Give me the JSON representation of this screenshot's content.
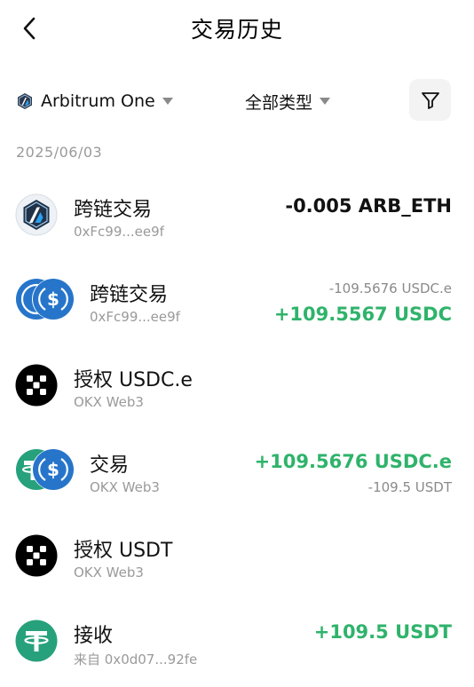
{
  "header": {
    "title": "交易历史"
  },
  "filters": {
    "network_label": "Arbitrum One",
    "type_label": "全部类型"
  },
  "date_group": "2025/06/03",
  "transactions": [
    {
      "title": "跨链交易",
      "subtitle": "0xFc99...ee9f",
      "amount": "-0.005 ARB_ETH",
      "icon": "arbitrum-logo-icon"
    },
    {
      "title": "跨链交易",
      "subtitle": "0xFc99...ee9f",
      "amount_sub": "-109.5676 USDC.e",
      "amount": "+109.5567 USDC",
      "icon": "usdc-pair-icon"
    },
    {
      "title": "授权 USDC.e",
      "subtitle": "OKX Web3",
      "icon": "okx-logo-icon"
    },
    {
      "title": "交易",
      "subtitle": "OKX Web3",
      "amount": "+109.5676 USDC.e",
      "amount_sub": "-109.5 USDT",
      "icon": "usdt-usdc-pair-icon"
    },
    {
      "title": "授权 USDT",
      "subtitle": "OKX Web3",
      "icon": "okx-logo-icon"
    },
    {
      "title": "接收",
      "subtitle": "来自 0x0d07...92fe",
      "amount": "+109.5 USDT",
      "icon": "usdt-logo-icon"
    }
  ],
  "colors": {
    "positive": "#2fb36b",
    "usdc": "#2775ca",
    "tether": "#26a17b",
    "arbitrum": "#213147"
  }
}
